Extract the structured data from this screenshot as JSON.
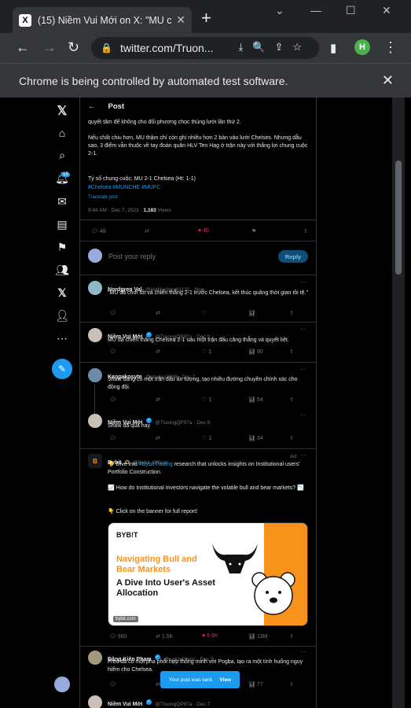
{
  "browser": {
    "tab_title": "(15) Niềm Vui Mới on X: \"MU c",
    "favicon": "X",
    "url": "twitter.com/Truon...",
    "profile_initial": "H",
    "infobar_text": "Chrome is being controlled by automated test software."
  },
  "nav": {
    "notification_count": "15"
  },
  "post": {
    "header": "Post",
    "line1": "quyết tâm để không cho đối phương chọc thủng lưới lần thứ 2.",
    "para2": "Nếu chất chiu hơn, MU thậm chí còn ghi nhiều hơn 2 bàn vào lưới Chelses. Nhưng dẫu sao, 3 điểm vẫn thuộc về tay đoàn quân HLV Ten Hag ở trận này với thắng lợi chung cuộc 2-1.",
    "score": "Tỷ số chung cuộc: MU 2-1 Chelsea (Ht: 1-1)",
    "hashtags": "#Chelsea #MUNCHE #MUFC",
    "translate": "Translate post",
    "time": "9:48 AM · Dec 7, 2023 · ",
    "views_count": "1,183",
    "views_label": " Views",
    "replies": "48",
    "likes": "40"
  },
  "reply_box": {
    "placeholder": "Post your reply",
    "button": "Reply"
  },
  "replies": [
    {
      "name": "Nordgren Val",
      "handle": "@ValNordgre81131 · Now",
      "text": "\"MU đã chơi tốt và chiến thắng 2-1 trước Chelsea, kết thúc quãng thời gian tồi tệ.\"",
      "avatar_color": "#8fb8c9"
    },
    {
      "name": "Niềm Vui Mới",
      "handle": "@TruongQP97a · Dec 9",
      "text": "MU đã chiến thắng Chelsea 2-1 sau một trận đấu căng thẳng và quyết liệt.",
      "likes": "1",
      "views": "90",
      "avatar_color": "#c9c0b8"
    },
    {
      "name": "Kanpakosyte",
      "handle": "@chetao2008 · Dec 7",
      "text": "Shaw đang có một trận đấu ấn tượng, tạo nhiều đường chuyền chính xác cho đồng đội.",
      "likes": "1",
      "views": "54",
      "avatar_color": "#6d8aa6"
    },
    {
      "name": "Niềm Vui Mới",
      "handle": "@TruongQP97a · Dec 9",
      "text": "Shaw đá quá hay",
      "likes": "1",
      "views": "34",
      "avatar_color": "#c9c0b8"
    }
  ],
  "ad": {
    "name": "Bybit",
    "handle": "@Bybit_Official",
    "label": "Ad",
    "text1_prefix": "💡 Dive into ",
    "text1_link": "#BybitTrading",
    "text1_suffix": " research that unlocks insights on Institutional users' Portfolio Construction.",
    "text2": "📈 How do Institutional Investors navigate the volatile bull and bear markets? 📉",
    "text3": "👇 Click on the banner for full report!",
    "card_logo": "BYB!T",
    "card_title": "Navigating Bull and Bear Markets",
    "card_subtitle": "A Dive Into User's Asset Allocation",
    "card_domain": "bybit.com",
    "replies": "660",
    "reposts": "1.5K",
    "likes": "6.6K",
    "views": "13M"
  },
  "last_reply": {
    "name": "Đăng Kiên Phạm",
    "handle": "@ngKinPhm1 · Dec 7",
    "text": "Fred đã có một pha phối hợp thông minh với Pogba, tạo ra một tình huống nguy hiểm cho Chelsea.",
    "views": "77"
  },
  "partial_reply": {
    "name": "Niềm Vui Mới",
    "handle": "@TruongQP97a · Dec 7"
  },
  "toast": {
    "text": "Your post was sent.",
    "action": "View"
  }
}
